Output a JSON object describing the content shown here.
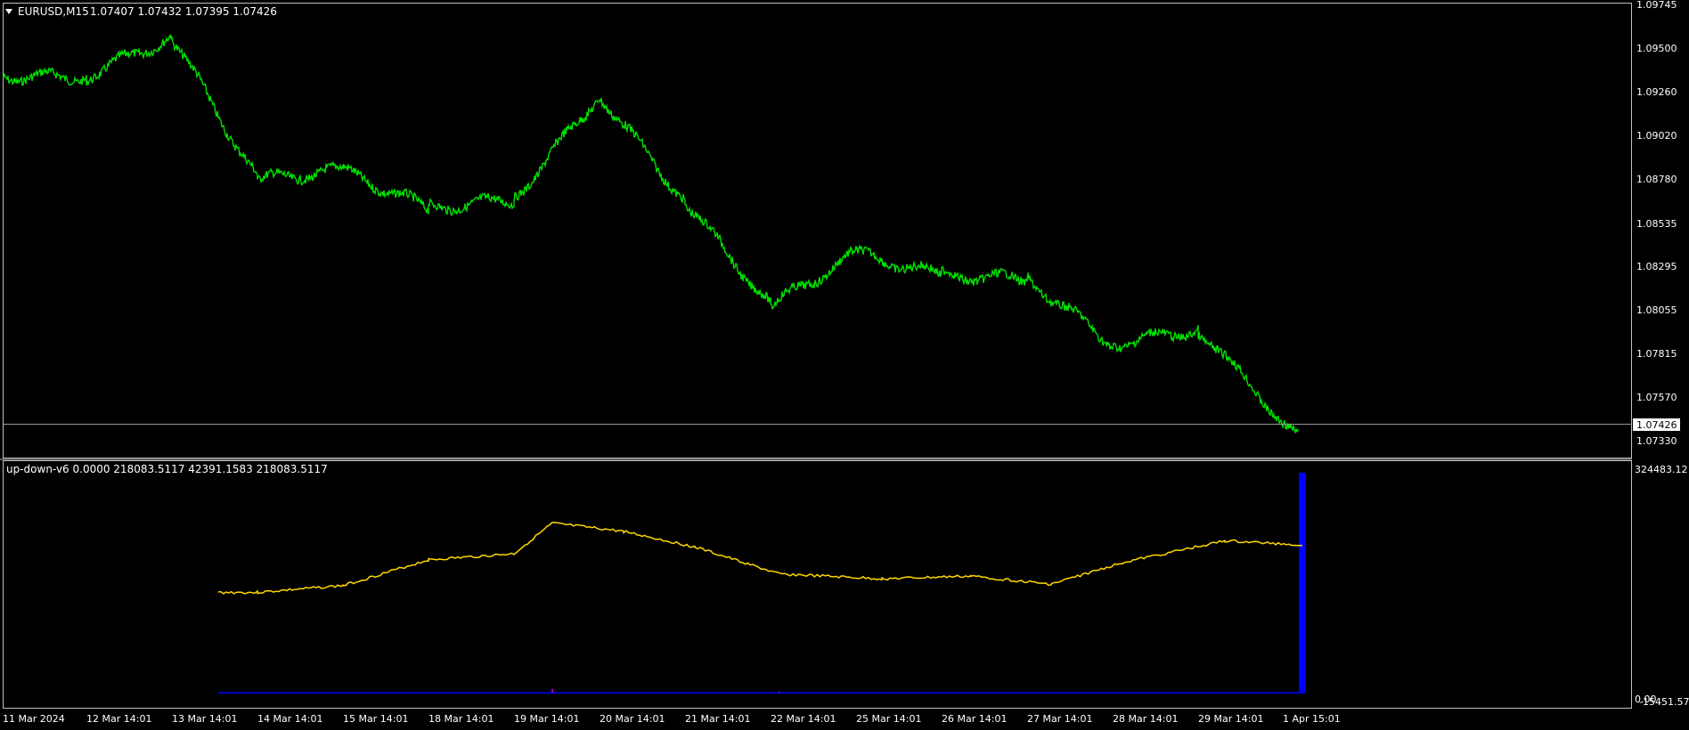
{
  "main_label": {
    "arrow": "triangle-down-icon",
    "symbol": "EURUSD,M15",
    "ohlc": "1.07407 1.07432 1.07395 1.07426"
  },
  "price_axis": [
    "1.09745",
    "1.09500",
    "1.09260",
    "1.09020",
    "1.08780",
    "1.08535",
    "1.08295",
    "1.08055",
    "1.07815",
    "1.07570",
    "1.07330"
  ],
  "current_price": "1.07426",
  "indicator_label": "up-down-v6 0.0000 218083.5117 42391.1583 218083.5117",
  "indicator_axis": {
    "top": "324483.12",
    "zero": "0.00",
    "bottom": "-15451.57"
  },
  "time_axis": [
    "11 Mar 2024",
    "12 Mar 14:01",
    "13 Mar 14:01",
    "14 Mar 14:01",
    "15 Mar 14:01",
    "18 Mar 14:01",
    "19 Mar 14:01",
    "20 Mar 14:01",
    "21 Mar 14:01",
    "22 Mar 14:01",
    "25 Mar 14:01",
    "26 Mar 14:01",
    "27 Mar 14:01",
    "28 Mar 14:01",
    "29 Mar 14:01",
    "1 Apr 15:01"
  ],
  "colors": {
    "price_line": "#00e000",
    "indicator_line": "#ffd700",
    "histogram": "#0000ff",
    "histogram_alt": "#9900cc",
    "frame": "#c0c0c0",
    "text": "#ffffff"
  },
  "chart_data": [
    {
      "type": "line",
      "title": "EURUSD,M15",
      "ylim": [
        1.0733,
        1.09745
      ],
      "grid": false,
      "x": [
        "11 Mar 2024",
        "12 Mar 14:01",
        "13 Mar 14:01",
        "14 Mar 14:01",
        "15 Mar 14:01",
        "18 Mar 14:01",
        "19 Mar 14:01",
        "20 Mar 14:01",
        "21 Mar 14:01",
        "22 Mar 14:01",
        "25 Mar 14:01",
        "26 Mar 14:01",
        "27 Mar 14:01",
        "28 Mar 14:01",
        "29 Mar 14:01",
        "1 Apr 15:01"
      ],
      "series": [
        {
          "values": [
            1.0935,
            1.0935,
            1.0957,
            1.0878,
            1.0883,
            1.0862,
            1.0867,
            1.0925,
            1.0866,
            1.0808,
            1.0837,
            1.0825,
            1.0823,
            1.0787,
            1.0795,
            1.0735
          ]
        }
      ]
    },
    {
      "type": "line",
      "title": "up-down-v6",
      "ylim": [
        -15451.57,
        324483.12
      ],
      "grid": false,
      "x": [
        "12 Mar 14:01",
        "13 Mar 14:01",
        "14 Mar 14:01",
        "15 Mar 14:01",
        "18 Mar 14:01",
        "19 Mar 14:01",
        "20 Mar 14:01",
        "21 Mar 14:01",
        "22 Mar 14:01",
        "25 Mar 14:01",
        "26 Mar 14:01",
        "27 Mar 14:01",
        "28 Mar 14:01",
        "29 Mar 14:01",
        "1 Apr 15:01"
      ],
      "series": [
        {
          "values": [
            148000,
            148000,
            158000,
            196000,
            205000,
            250000,
            238000,
            215000,
            175000,
            168000,
            172000,
            160000,
            192000,
            224000,
            218083.5117
          ]
        },
        {
          "values": [
            0,
            0,
            0,
            0,
            0,
            6000,
            0,
            0,
            2000,
            0,
            0,
            0,
            0,
            0,
            324483.12
          ]
        }
      ]
    }
  ]
}
